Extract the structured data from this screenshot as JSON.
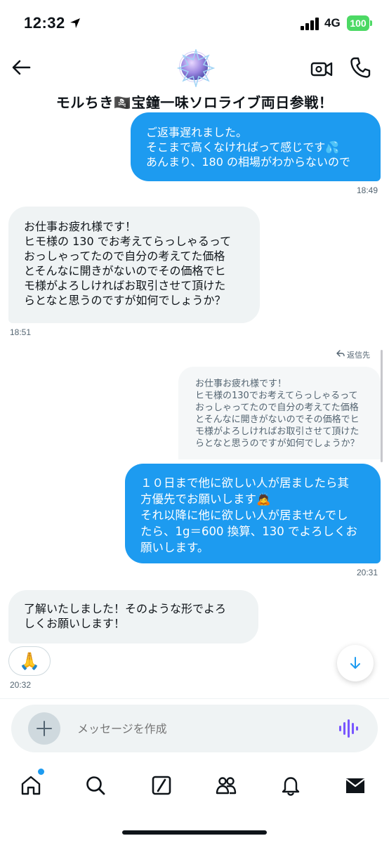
{
  "status_bar": {
    "time": "12:32",
    "network": "4G",
    "battery": "100"
  },
  "header": {
    "title": "モルちき🏴‍☠️宝鐘一味ソロライブ両日参戦！"
  },
  "messages": [
    {
      "direction": "sent",
      "text": "ご返事遅れました。\nそこまで高くなければって感じです💦\nあんまり、180 の相場がわからないので",
      "time": "18:49"
    },
    {
      "direction": "received",
      "text": "お仕事お疲れ様です！\nヒモ様の 130 でお考えてらっしゃるって\nおっしゃってたので自分の考えてた価格\nとそんなに開きがないのでその価格でヒ\nモ様がよろしければお取引させて頂けた\nらとなと思うのですが如何でしょうか？",
      "time": "18:51"
    },
    {
      "direction": "sent",
      "reply_label": "返信先",
      "quoted": "お仕事お疲れ様です！\nヒモ様の130でお考えてらっしゃるって\nおっしゃってたので自分の考えてた価格\nとそんなに開きがないのでその価格でヒ\nモ様がよろしければお取引させて頂けた\nらとなと思うのですが如何でしょうか？",
      "text": "１０日まで他に欲しい人が居ましたら其\n方優先でお願いします🙇\nそれ以降に他に欲しい人が居ませんでし\nたら、1g＝600 換算、130 でよろしくお\n願いします。",
      "time": "20:31"
    },
    {
      "direction": "received",
      "text": "了解いたしました！そのような形でよろ\nしくお願いします！",
      "reaction": "🙏",
      "time": "20:32"
    }
  ],
  "composer": {
    "placeholder": "メッセージを作成"
  },
  "colors": {
    "accent": "#1d9bf0",
    "received_bubble": "#eff3f4",
    "voice": "#7856ff"
  },
  "tabs": [
    "home-icon",
    "search-icon",
    "grok-icon",
    "communities-icon",
    "notifications-icon",
    "messages-icon"
  ]
}
